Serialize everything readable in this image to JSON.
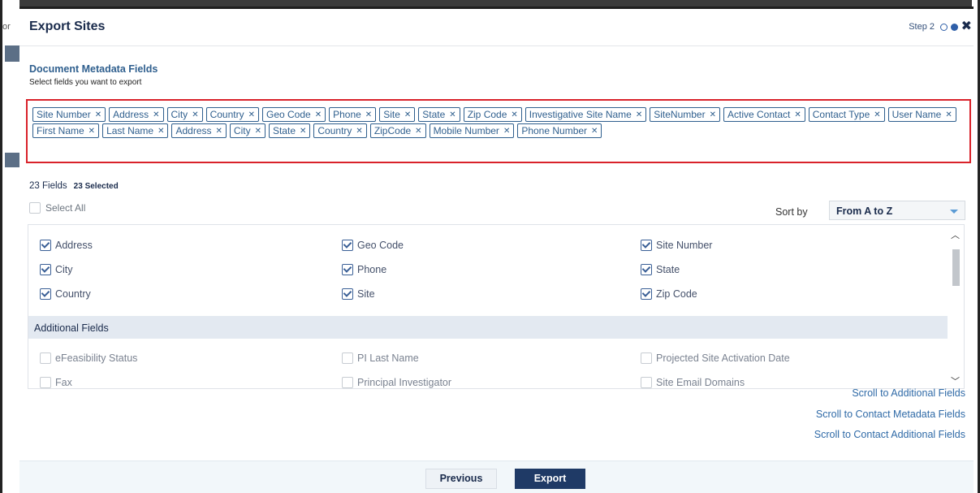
{
  "background": {
    "left_fragment": "or"
  },
  "modal": {
    "title": "Export Sites",
    "step_label": "Step 2"
  },
  "metadata": {
    "title": "Document Metadata Fields",
    "subtitle": "Select fields you want to export"
  },
  "selected_tags": [
    "Site Number",
    "Address",
    "City",
    "Country",
    "Geo Code",
    "Phone",
    "Site",
    "State",
    "Zip Code",
    "Investigative Site Name",
    "SiteNumber",
    "Active Contact",
    "Contact Type",
    "User Name",
    "First Name",
    "Last Name",
    "Address",
    "City",
    "State",
    "Country",
    "ZipCode",
    "Mobile Number",
    "Phone Number"
  ],
  "counts": {
    "fields": "23 Fields",
    "selected": "23 Selected"
  },
  "select_all_label": "Select All",
  "sort": {
    "label": "Sort by",
    "value": "From A to Z"
  },
  "fields": {
    "col1": [
      {
        "label": "Address",
        "checked": true
      },
      {
        "label": "City",
        "checked": true
      },
      {
        "label": "Country",
        "checked": true
      }
    ],
    "col2": [
      {
        "label": "Geo Code",
        "checked": true
      },
      {
        "label": "Phone",
        "checked": true
      },
      {
        "label": "Site",
        "checked": true
      }
    ],
    "col3": [
      {
        "label": "Site Number",
        "checked": true
      },
      {
        "label": "State",
        "checked": true
      },
      {
        "label": "Zip Code",
        "checked": true
      }
    ]
  },
  "additional": {
    "header": "Additional Fields",
    "col1": [
      {
        "label": "eFeasibility Status",
        "checked": false
      },
      {
        "label": "Fax",
        "checked": false
      }
    ],
    "col2": [
      {
        "label": "PI Last Name",
        "checked": false
      },
      {
        "label": "Principal Investigator",
        "checked": false
      }
    ],
    "col3": [
      {
        "label": "Projected Site Activation Date",
        "checked": false
      },
      {
        "label": "Site Email Domains",
        "checked": false
      }
    ]
  },
  "scroll_links": [
    "Scroll to Additional Fields",
    "Scroll to Contact Metadata Fields",
    "Scroll to Contact Additional Fields"
  ],
  "buttons": {
    "previous": "Previous",
    "export": "Export"
  }
}
